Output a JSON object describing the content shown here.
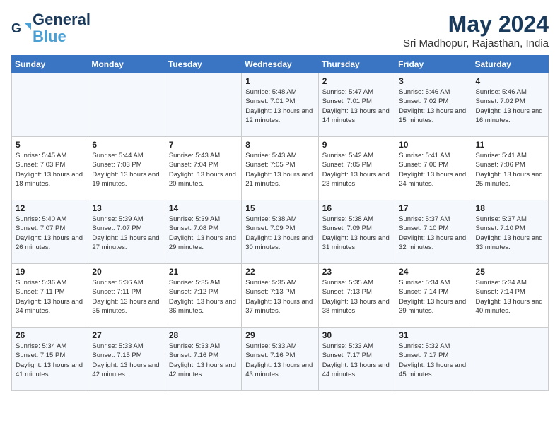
{
  "logo": {
    "line1": "General",
    "line2": "Blue"
  },
  "title": "May 2024",
  "location": "Sri Madhopur, Rajasthan, India",
  "weekdays": [
    "Sunday",
    "Monday",
    "Tuesday",
    "Wednesday",
    "Thursday",
    "Friday",
    "Saturday"
  ],
  "weeks": [
    [
      {
        "day": "",
        "info": ""
      },
      {
        "day": "",
        "info": ""
      },
      {
        "day": "",
        "info": ""
      },
      {
        "day": "1",
        "info": "Sunrise: 5:48 AM\nSunset: 7:01 PM\nDaylight: 13 hours\nand 12 minutes."
      },
      {
        "day": "2",
        "info": "Sunrise: 5:47 AM\nSunset: 7:01 PM\nDaylight: 13 hours\nand 14 minutes."
      },
      {
        "day": "3",
        "info": "Sunrise: 5:46 AM\nSunset: 7:02 PM\nDaylight: 13 hours\nand 15 minutes."
      },
      {
        "day": "4",
        "info": "Sunrise: 5:46 AM\nSunset: 7:02 PM\nDaylight: 13 hours\nand 16 minutes."
      }
    ],
    [
      {
        "day": "5",
        "info": "Sunrise: 5:45 AM\nSunset: 7:03 PM\nDaylight: 13 hours\nand 18 minutes."
      },
      {
        "day": "6",
        "info": "Sunrise: 5:44 AM\nSunset: 7:03 PM\nDaylight: 13 hours\nand 19 minutes."
      },
      {
        "day": "7",
        "info": "Sunrise: 5:43 AM\nSunset: 7:04 PM\nDaylight: 13 hours\nand 20 minutes."
      },
      {
        "day": "8",
        "info": "Sunrise: 5:43 AM\nSunset: 7:05 PM\nDaylight: 13 hours\nand 21 minutes."
      },
      {
        "day": "9",
        "info": "Sunrise: 5:42 AM\nSunset: 7:05 PM\nDaylight: 13 hours\nand 23 minutes."
      },
      {
        "day": "10",
        "info": "Sunrise: 5:41 AM\nSunset: 7:06 PM\nDaylight: 13 hours\nand 24 minutes."
      },
      {
        "day": "11",
        "info": "Sunrise: 5:41 AM\nSunset: 7:06 PM\nDaylight: 13 hours\nand 25 minutes."
      }
    ],
    [
      {
        "day": "12",
        "info": "Sunrise: 5:40 AM\nSunset: 7:07 PM\nDaylight: 13 hours\nand 26 minutes."
      },
      {
        "day": "13",
        "info": "Sunrise: 5:39 AM\nSunset: 7:07 PM\nDaylight: 13 hours\nand 27 minutes."
      },
      {
        "day": "14",
        "info": "Sunrise: 5:39 AM\nSunset: 7:08 PM\nDaylight: 13 hours\nand 29 minutes."
      },
      {
        "day": "15",
        "info": "Sunrise: 5:38 AM\nSunset: 7:09 PM\nDaylight: 13 hours\nand 30 minutes."
      },
      {
        "day": "16",
        "info": "Sunrise: 5:38 AM\nSunset: 7:09 PM\nDaylight: 13 hours\nand 31 minutes."
      },
      {
        "day": "17",
        "info": "Sunrise: 5:37 AM\nSunset: 7:10 PM\nDaylight: 13 hours\nand 32 minutes."
      },
      {
        "day": "18",
        "info": "Sunrise: 5:37 AM\nSunset: 7:10 PM\nDaylight: 13 hours\nand 33 minutes."
      }
    ],
    [
      {
        "day": "19",
        "info": "Sunrise: 5:36 AM\nSunset: 7:11 PM\nDaylight: 13 hours\nand 34 minutes."
      },
      {
        "day": "20",
        "info": "Sunrise: 5:36 AM\nSunset: 7:11 PM\nDaylight: 13 hours\nand 35 minutes."
      },
      {
        "day": "21",
        "info": "Sunrise: 5:35 AM\nSunset: 7:12 PM\nDaylight: 13 hours\nand 36 minutes."
      },
      {
        "day": "22",
        "info": "Sunrise: 5:35 AM\nSunset: 7:13 PM\nDaylight: 13 hours\nand 37 minutes."
      },
      {
        "day": "23",
        "info": "Sunrise: 5:35 AM\nSunset: 7:13 PM\nDaylight: 13 hours\nand 38 minutes."
      },
      {
        "day": "24",
        "info": "Sunrise: 5:34 AM\nSunset: 7:14 PM\nDaylight: 13 hours\nand 39 minutes."
      },
      {
        "day": "25",
        "info": "Sunrise: 5:34 AM\nSunset: 7:14 PM\nDaylight: 13 hours\nand 40 minutes."
      }
    ],
    [
      {
        "day": "26",
        "info": "Sunrise: 5:34 AM\nSunset: 7:15 PM\nDaylight: 13 hours\nand 41 minutes."
      },
      {
        "day": "27",
        "info": "Sunrise: 5:33 AM\nSunset: 7:15 PM\nDaylight: 13 hours\nand 42 minutes."
      },
      {
        "day": "28",
        "info": "Sunrise: 5:33 AM\nSunset: 7:16 PM\nDaylight: 13 hours\nand 42 minutes."
      },
      {
        "day": "29",
        "info": "Sunrise: 5:33 AM\nSunset: 7:16 PM\nDaylight: 13 hours\nand 43 minutes."
      },
      {
        "day": "30",
        "info": "Sunrise: 5:33 AM\nSunset: 7:17 PM\nDaylight: 13 hours\nand 44 minutes."
      },
      {
        "day": "31",
        "info": "Sunrise: 5:32 AM\nSunset: 7:17 PM\nDaylight: 13 hours\nand 45 minutes."
      },
      {
        "day": "",
        "info": ""
      }
    ]
  ]
}
